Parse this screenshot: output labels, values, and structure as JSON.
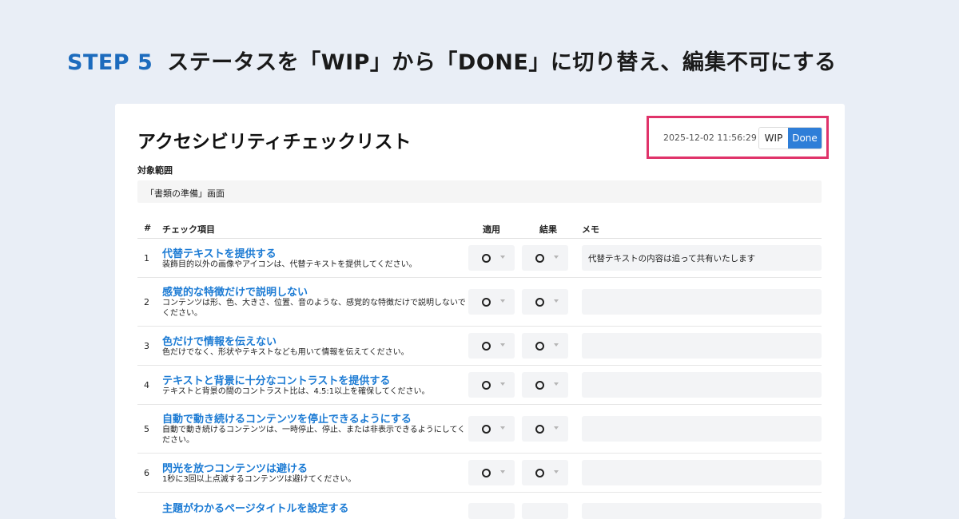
{
  "heading": {
    "step": "STEP 5",
    "text": "ステータスを「WIP」から「DONE」に切り替え、編集不可にする"
  },
  "card": {
    "title": "アクセシビリティチェックリスト",
    "timestamp": "2025-12-02 11:56:29",
    "status_toggle": {
      "wip_label": "WIP",
      "done_label": "Done",
      "selected": "Done"
    },
    "scope_label": "対象範囲",
    "scope_value": "「書類の準備」画面"
  },
  "table": {
    "headers": {
      "num": "#",
      "item": "チェック項目",
      "apply": "適用",
      "result": "結果",
      "memo": "メモ"
    },
    "rows": [
      {
        "num": "1",
        "title": "代替テキストを提供する",
        "desc": "装飾目的以外の画像やアイコンは、代替テキストを提供してください。",
        "memo": "代替テキストの内容は追って共有いたします"
      },
      {
        "num": "2",
        "title": "感覚的な特徴だけで説明しない",
        "desc": "コンテンツは形、色、大きさ、位置、音のような、感覚的な特徴だけで説明しないでください。",
        "memo": ""
      },
      {
        "num": "3",
        "title": "色だけで情報を伝えない",
        "desc": "色だけでなく、形状やテキストなども用いて情報を伝えてください。",
        "memo": ""
      },
      {
        "num": "4",
        "title": "テキストと背景に十分なコントラストを提供する",
        "desc": "テキストと背景の間のコントラスト比は、4.5:1以上を確保してください。",
        "memo": ""
      },
      {
        "num": "5",
        "title": "自動で動き続けるコンテンツを停止できるようにする",
        "desc": "自動で動き続けるコンテンツは、一時停止、停止、または非表示できるようにしてください。",
        "memo": ""
      },
      {
        "num": "6",
        "title": "閃光を放つコンテンツは避ける",
        "desc": "1秒に3回以上点滅するコンテンツは避けてください。",
        "memo": ""
      }
    ],
    "partial_row_title": "主題がわかるページタイトルを設定する"
  },
  "colors": {
    "accent": "#1c6bbd",
    "link": "#1c7bd4",
    "done_button": "#2e7ed8",
    "highlight_border": "#e0336a",
    "background": "#e9eef6"
  },
  "icons": {
    "select_value": "circle-icon",
    "select_caret": "chevron-down-icon"
  }
}
